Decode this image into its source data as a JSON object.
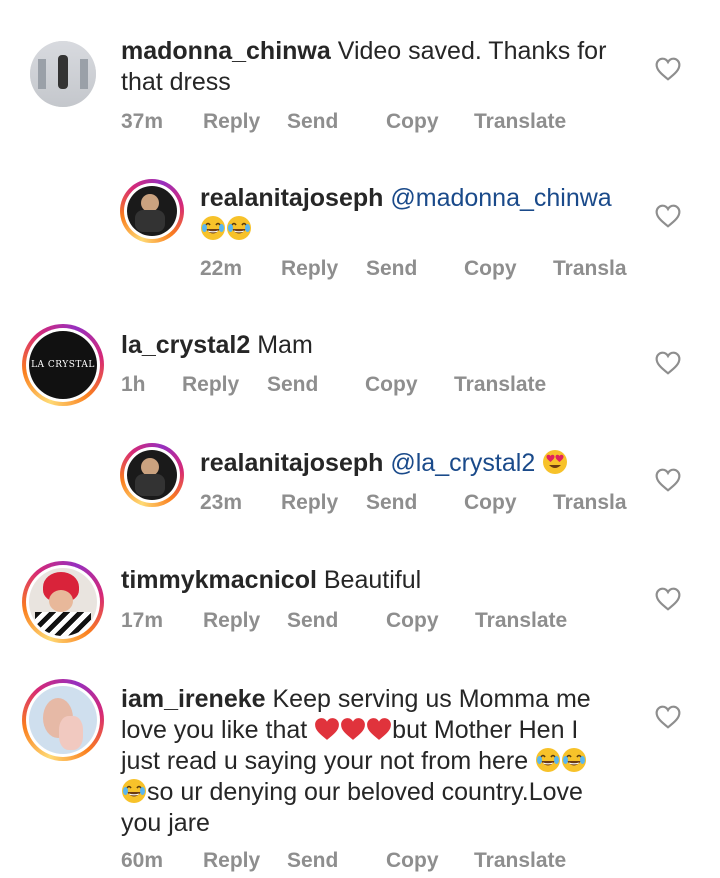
{
  "comments": [
    {
      "username": "madonna_chinwa",
      "text_lines": [
        "Video saved. Thanks for",
        "that dress"
      ],
      "time": "37m",
      "actions": [
        "Reply",
        "Send",
        "Copy",
        "Translate"
      ]
    },
    {
      "username": "realanitajoseph",
      "text_lines": [
        "@madonna_chinwa",
        ""
      ],
      "time": "22m",
      "actions": [
        "Reply",
        "Send",
        "Copy",
        "Transla"
      ]
    },
    {
      "username": "la_crystal2",
      "avatar_text": "LA CRYSTAL",
      "text_lines": [
        "Mam"
      ],
      "time": "1h",
      "actions": [
        "Reply",
        "Send",
        "Copy",
        "Translate"
      ]
    },
    {
      "username": "realanitajoseph",
      "text_lines": [
        "@la_crystal2"
      ],
      "time": "23m",
      "actions": [
        "Reply",
        "Send",
        "Copy",
        "Transla"
      ]
    },
    {
      "username": "timmykmacnicol",
      "text_lines": [
        "Beautiful"
      ],
      "time": "17m",
      "actions": [
        "Reply",
        "Send",
        "Copy",
        "Translate"
      ]
    },
    {
      "username": "iam_ireneke",
      "text_lines": [
        "Keep serving us Momma me",
        "love you like that",
        "but Mother Hen I",
        "just read u saying your not from here",
        "so ur denying our beloved country.Love",
        "you jare"
      ],
      "time": "60m",
      "actions": [
        "Reply",
        "Send",
        "Copy",
        "Translate"
      ]
    }
  ],
  "colors": {
    "meta": "#8e8e8e",
    "text": "#262626",
    "heart_stroke": "#8e8e8e"
  }
}
